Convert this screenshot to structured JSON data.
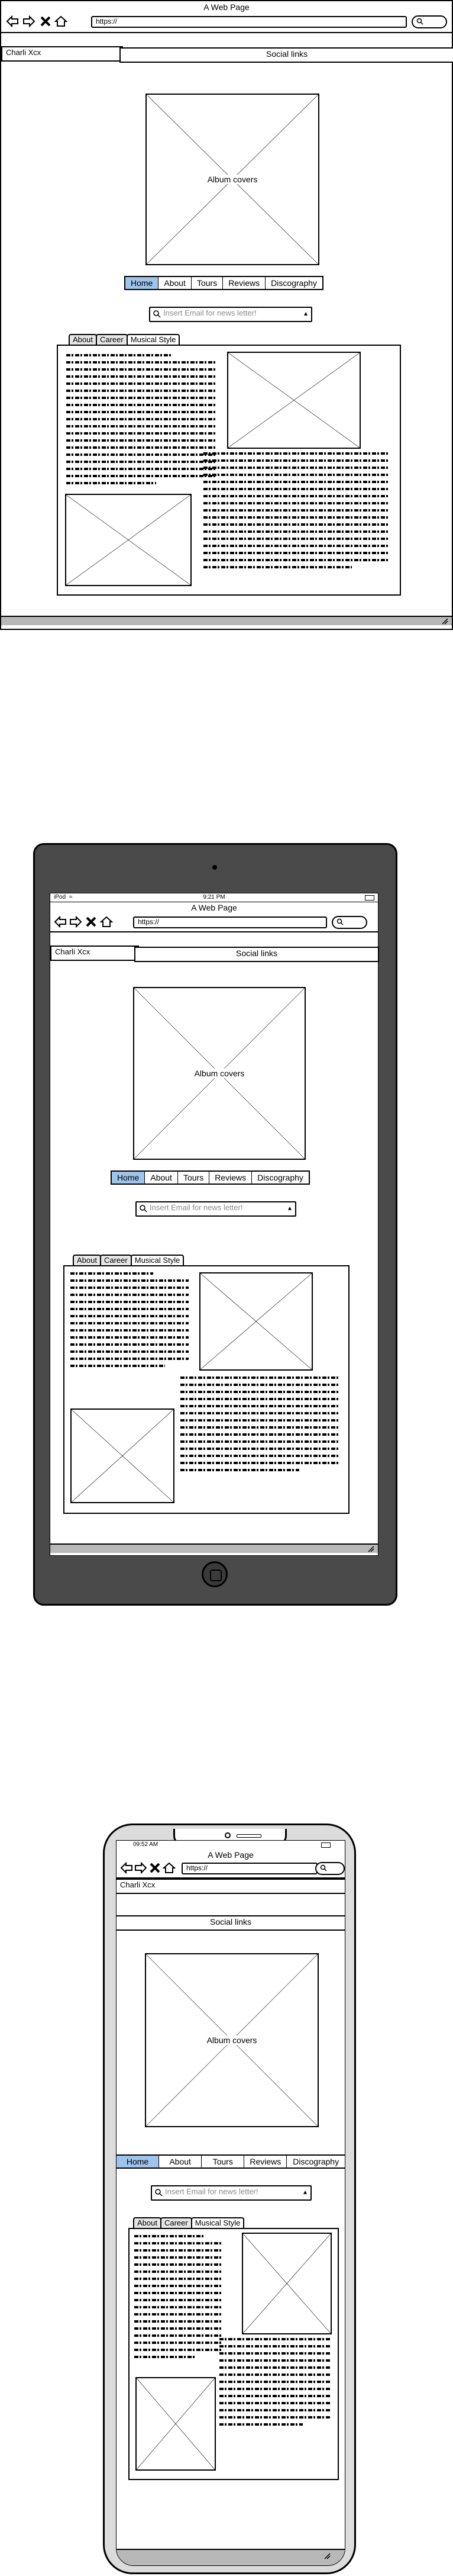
{
  "page": {
    "title": "A Web Page",
    "url": "https://",
    "brand": "Charli Xcx",
    "social_links": "Social links",
    "album_covers": "Album covers",
    "nav": [
      {
        "label": "Home",
        "active": true
      },
      {
        "label": "About",
        "active": false
      },
      {
        "label": "Tours",
        "active": false
      },
      {
        "label": "Reviews",
        "active": false
      },
      {
        "label": "Discography",
        "active": false
      }
    ],
    "newsletter_placeholder": "Insert Email for news letter!",
    "tabs": [
      {
        "label": "About",
        "active": false
      },
      {
        "label": "Career",
        "active": false
      },
      {
        "label": "Musical Style",
        "active": true
      }
    ]
  },
  "tablet": {
    "carrier": "iPod",
    "time": "9:21 PM"
  },
  "phone": {
    "time": "09:52 AM"
  },
  "colors": {
    "active_nav": "#9ec4ec",
    "tablet_frame": "#4a4a4a",
    "phone_frame": "#dcdcdc",
    "footer": "#b8b8b8"
  },
  "icons": [
    "back-arrow-icon",
    "forward-arrow-icon",
    "close-x-icon",
    "home-icon",
    "search-icon",
    "resize-grip-icon",
    "camera-icon",
    "home-button-icon",
    "wifi-icon",
    "battery-icon"
  ]
}
